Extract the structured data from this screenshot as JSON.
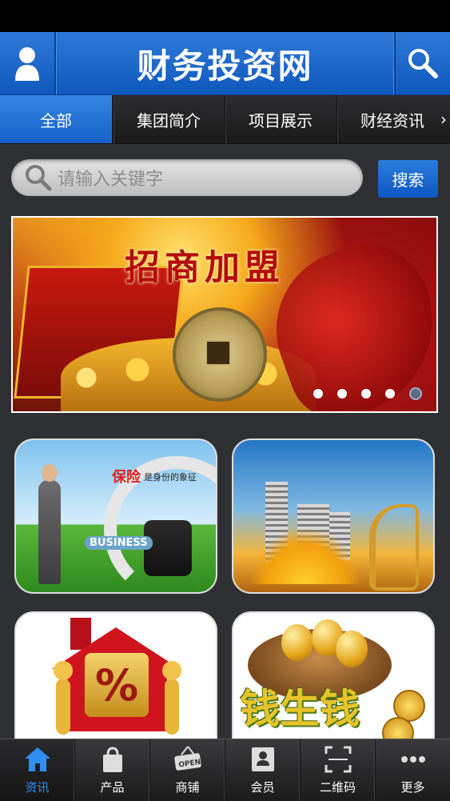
{
  "header": {
    "title": "财务投资网",
    "user_icon": "user-icon",
    "search_icon": "search-icon"
  },
  "tabs": {
    "items": [
      {
        "label": "全部",
        "active": true
      },
      {
        "label": "集团简介",
        "active": false
      },
      {
        "label": "项目展示",
        "active": false
      },
      {
        "label": "财经资讯",
        "active": false
      }
    ],
    "left_arrow": "‹",
    "right_arrow": "›"
  },
  "search": {
    "placeholder": "请输入关键字",
    "button_label": "搜索"
  },
  "banner": {
    "title": "招商加盟",
    "slides_total": 5,
    "active_slide": 5
  },
  "tiles": {
    "t1": {
      "slogan": "保险",
      "slogan_sub": "是身份的象征",
      "tag": "BUSINESS"
    },
    "t2": {},
    "t3": {
      "symbol": "%"
    },
    "t4": {
      "text": "钱生钱"
    }
  },
  "bottom_nav": {
    "items": [
      {
        "label": "资讯",
        "icon": "home-icon",
        "active": true
      },
      {
        "label": "产品",
        "icon": "shopping-bag-icon",
        "active": false
      },
      {
        "label": "商铺",
        "icon": "open-sign-icon",
        "active": false
      },
      {
        "label": "会员",
        "icon": "member-card-icon",
        "active": false
      },
      {
        "label": "二维码",
        "icon": "qr-scan-icon",
        "active": false
      },
      {
        "label": "更多",
        "icon": "more-icon",
        "active": false
      }
    ]
  },
  "colors": {
    "primary": "#1561c7",
    "active_nav": "#2f8ff0",
    "background": "#2f3033"
  }
}
